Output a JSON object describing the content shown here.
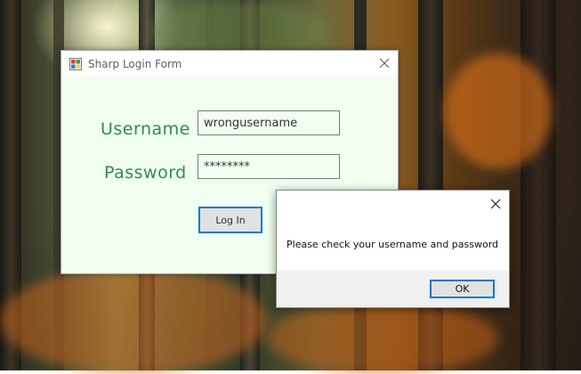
{
  "login_window": {
    "title": "Sharp Login Form",
    "username_label": "Username",
    "password_label": "Password",
    "username_value": "wrongusername",
    "password_value": "********",
    "login_button_label": "Log In"
  },
  "message_box": {
    "message": "Please check your username and password",
    "ok_label": "OK"
  },
  "colors": {
    "label_green": "#2f8a55",
    "form_background": "#f1fff0",
    "focus_blue": "#0078d7"
  },
  "icons": {
    "app_icon": "windows-form-icon",
    "close_icon": "close-icon"
  }
}
